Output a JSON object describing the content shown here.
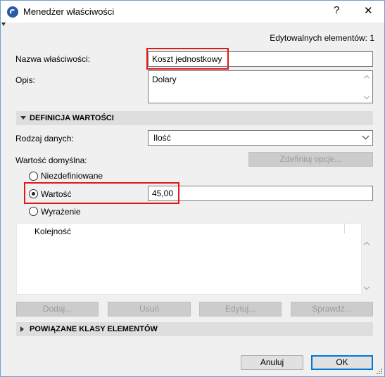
{
  "window": {
    "title": "Menedżer właściwości",
    "help_label": "?",
    "close_label": "✕"
  },
  "header": {
    "editable_count": "Edytowalnych elementów: 1"
  },
  "property": {
    "name_label": "Nazwa właściwości:",
    "name_value": "Koszt jednostkowy",
    "description_label": "Opis:",
    "description_value": "Dolary"
  },
  "value_definition": {
    "section_title": "DEFINICJA WARTOŚCI",
    "data_type_label": "Rodzaj danych:",
    "data_type_value": "Ilość",
    "default_value_label": "Wartość domyślna:",
    "define_options_label": "Zdefiniuj opcje...",
    "options": [
      {
        "label": "Niezdefiniowane",
        "selected": false
      },
      {
        "label": "Wartość",
        "selected": true
      },
      {
        "label": "Wyrażenie",
        "selected": false
      }
    ],
    "value_input": "45,00",
    "list_header": "Kolejność",
    "buttons": {
      "add": "Dodaj...",
      "remove": "Usuń",
      "edit": "Edytuj...",
      "check": "Sprawdź..."
    }
  },
  "related_classes": {
    "section_title": "POWIĄZANE KLASY ELEMENTÓW"
  },
  "footer": {
    "cancel": "Anuluj",
    "ok": "OK"
  },
  "colors": {
    "highlight": "#e01818",
    "accent": "#0078d7"
  }
}
